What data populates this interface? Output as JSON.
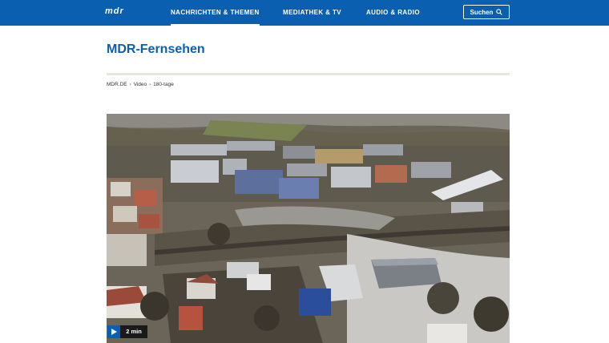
{
  "header": {
    "logo": "mdr",
    "nav": [
      "NACHRICHTEN & THEMEN",
      "MEDIATHEK & TV",
      "AUDIO & RADIO"
    ],
    "active_nav": "NACHRICHTEN & THEMEN",
    "search_label": "Suchen"
  },
  "page": {
    "title": "MDR-Fernsehen",
    "breadcrumb": [
      "MDR.DE",
      "Video",
      "180-tage"
    ]
  },
  "video": {
    "duration": "2 min"
  },
  "colors": {
    "brand_blue": "#0b5fb0",
    "divider": "#e9e7dc"
  }
}
